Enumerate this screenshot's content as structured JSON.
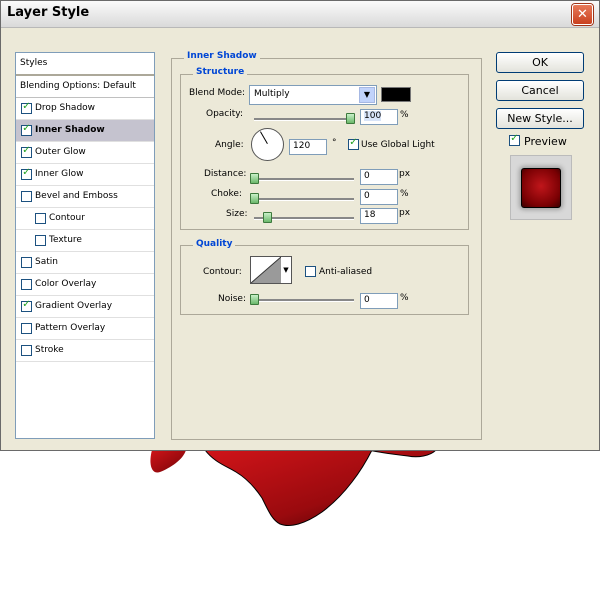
{
  "window": {
    "title": "Layer Style"
  },
  "styles_panel": {
    "header": "Styles",
    "blending_options": "Blending Options: Default",
    "items": [
      {
        "label": "Drop Shadow",
        "checked": true,
        "indent": false,
        "selected": false
      },
      {
        "label": "Inner Shadow",
        "checked": true,
        "indent": false,
        "selected": true
      },
      {
        "label": "Outer Glow",
        "checked": true,
        "indent": false,
        "selected": false
      },
      {
        "label": "Inner Glow",
        "checked": true,
        "indent": false,
        "selected": false
      },
      {
        "label": "Bevel and Emboss",
        "checked": false,
        "indent": false,
        "selected": false
      },
      {
        "label": "Contour",
        "checked": false,
        "indent": true,
        "selected": false
      },
      {
        "label": "Texture",
        "checked": false,
        "indent": true,
        "selected": false
      },
      {
        "label": "Satin",
        "checked": false,
        "indent": false,
        "selected": false
      },
      {
        "label": "Color Overlay",
        "checked": false,
        "indent": false,
        "selected": false
      },
      {
        "label": "Gradient Overlay",
        "checked": true,
        "indent": false,
        "selected": false
      },
      {
        "label": "Pattern Overlay",
        "checked": false,
        "indent": false,
        "selected": false
      },
      {
        "label": "Stroke",
        "checked": false,
        "indent": false,
        "selected": false
      }
    ]
  },
  "inner_shadow": {
    "section_title": "Inner Shadow",
    "structure": {
      "title": "Structure",
      "blend_mode_label": "Blend Mode:",
      "blend_mode_value": "Multiply",
      "shadow_color": "#000000",
      "opacity_label": "Opacity:",
      "opacity_value": "100",
      "opacity_level": 1.0,
      "opacity_unit": "%",
      "angle_label": "Angle:",
      "angle_value": "120",
      "angle_unit": "°",
      "use_global_light_label": "Use Global Light",
      "use_global_light_checked": true,
      "distance_label": "Distance:",
      "distance_value": "0",
      "distance_unit": "px",
      "choke_label": "Choke:",
      "choke_value": "0",
      "choke_unit": "%",
      "size_label": "Size:",
      "size_value": "18",
      "size_unit": "px"
    },
    "quality": {
      "title": "Quality",
      "contour_label": "Contour:",
      "anti_aliased_label": "Anti-aliased",
      "anti_aliased_checked": false,
      "noise_label": "Noise:",
      "noise_value": "0",
      "noise_unit": "%"
    }
  },
  "buttons": {
    "ok": "OK",
    "cancel": "Cancel",
    "new_style": "New Style..."
  },
  "preview": {
    "label": "Preview",
    "checked": true,
    "swatch_color": "#a00a0f"
  },
  "colors": {
    "accent_title": "#0046d5",
    "selected_row": "#c5c3cf",
    "object_red": "#b10d12"
  }
}
